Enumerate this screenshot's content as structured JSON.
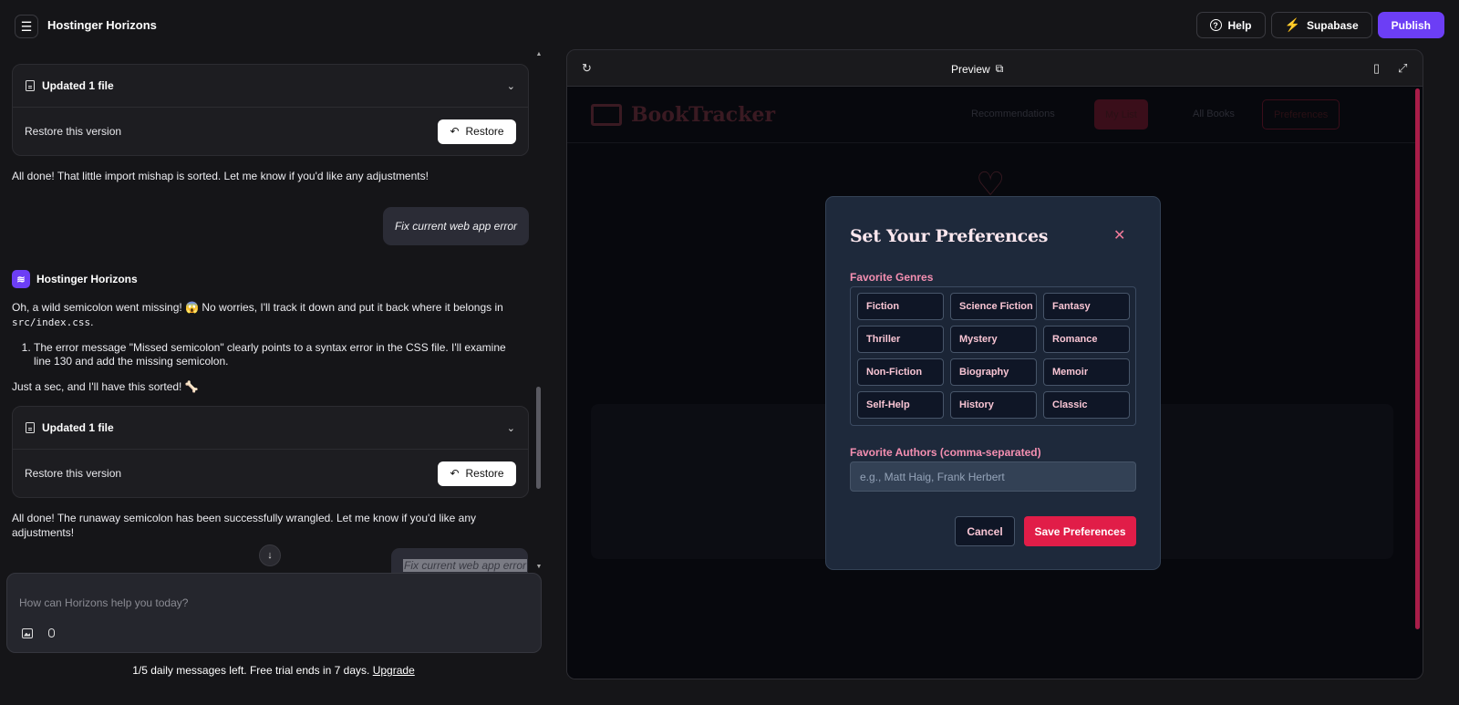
{
  "app": {
    "title": "Hostinger Horizons"
  },
  "topbar": {
    "help_label": "Help",
    "supabase_label": "Supabase",
    "publish_label": "Publish"
  },
  "chat": {
    "file_card_1": {
      "title": "Updated 1 file",
      "restore_text": "Restore this version",
      "restore_label": "Restore"
    },
    "msg_done_1": "All done! That little import mishap is sorted. Let me know if you'd like any adjustments!",
    "user_msg_1": "Fix current web app error",
    "bot_name": "Hostinger Horizons",
    "bot_intro": "Oh, a wild semicolon went missing! 😱 No worries, I'll track it down and put it back where it belongs in",
    "bot_intro_code": "src/index.css",
    "bot_step_1": "The error message \"Missed semicolon\" clearly points to a syntax error in the CSS file. I'll examine line 130 and add the missing semicolon.",
    "bot_wait": "Just a sec, and I'll have this sorted! 🦴",
    "file_card_2": {
      "title": "Updated 1 file",
      "restore_text": "Restore this version",
      "restore_label": "Restore"
    },
    "msg_done_2": "All done! The runaway semicolon has been successfully wrangled. Let me know if you'd like any adjustments!",
    "user_msg_2": "Fix current web app error"
  },
  "composer": {
    "placeholder": "How can Horizons help you today?"
  },
  "footer": {
    "note": "1/5 daily messages left. Free trial ends in 7 days.",
    "upgrade_label": "Upgrade"
  },
  "preview": {
    "title": "Preview",
    "modal": {
      "title": "Set Your Preferences",
      "genres_label": "Favorite Genres",
      "genres": [
        "Fiction",
        "Science Fiction",
        "Fantasy",
        "Thriller",
        "Mystery",
        "Romance",
        "Non-Fiction",
        "Biography",
        "Memoir",
        "Self-Help",
        "History",
        "Classic"
      ],
      "authors_label": "Favorite Authors (comma-separated)",
      "authors_placeholder": "e.g., Matt Haig, Frank Herbert",
      "cancel_label": "Cancel",
      "save_label": "Save Preferences"
    },
    "background_app": {
      "logo": "BookTracker",
      "nav": [
        "Recommendations",
        "My List",
        "All Books",
        "Preferences"
      ]
    }
  },
  "colors": {
    "accent": "#6c3ef5",
    "brand_pink": "#e11d48",
    "supabase_green": "#3ecf8e"
  }
}
